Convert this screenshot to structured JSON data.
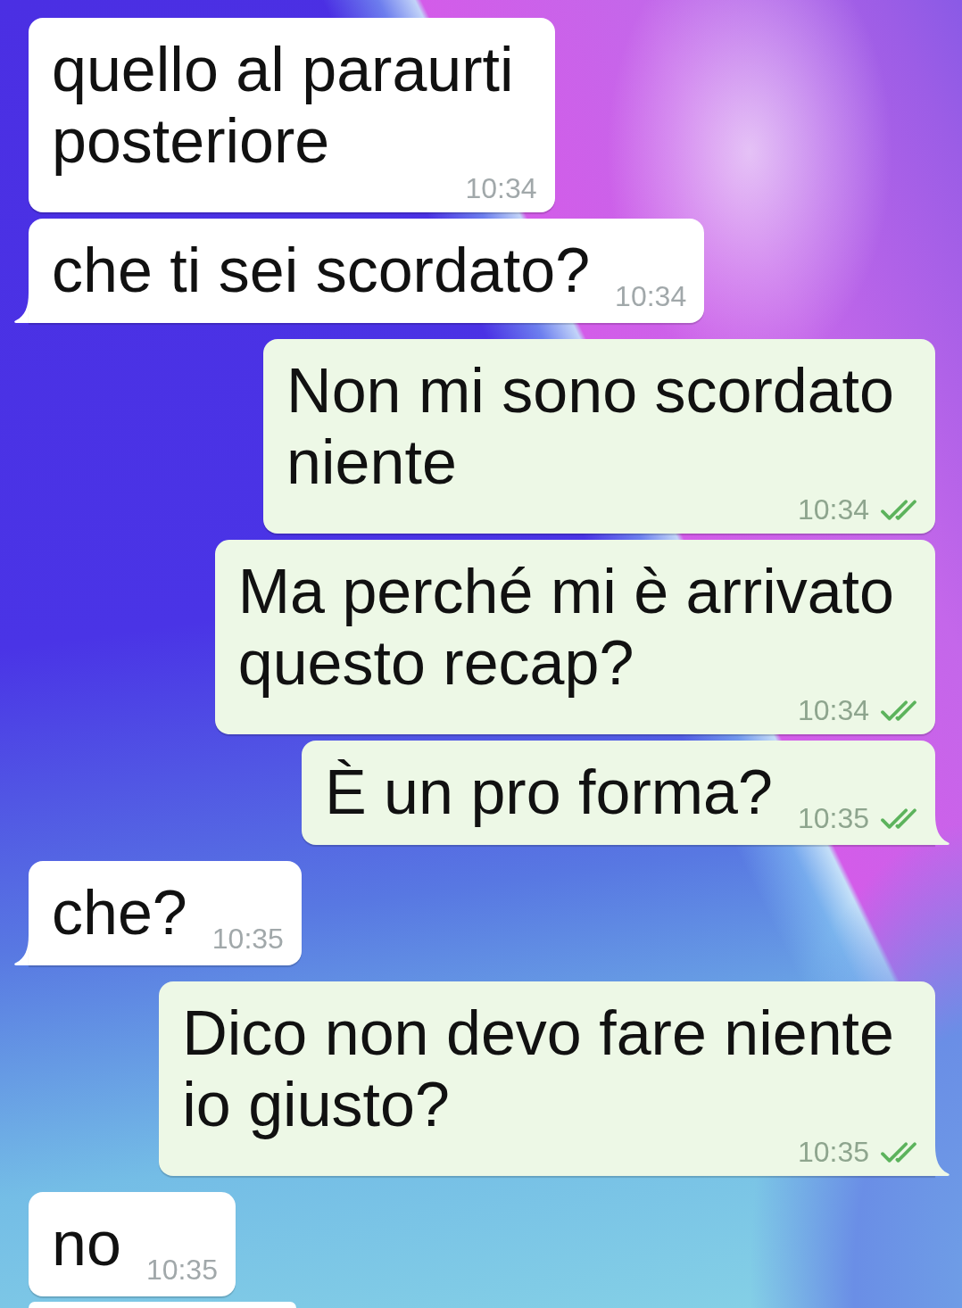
{
  "messages": [
    {
      "kind": "incoming",
      "lines": [
        "quello al paraurti",
        "posteriore"
      ],
      "time": "10:34",
      "tail": false
    },
    {
      "kind": "incoming",
      "lines": [
        "che ti sei scordato?"
      ],
      "time": "10:34",
      "tail": true
    },
    {
      "kind": "outgoing",
      "lines": [
        "Non mi sono scordato",
        "niente"
      ],
      "time": "10:34",
      "read": true,
      "tail": false
    },
    {
      "kind": "outgoing",
      "lines": [
        "Ma perché mi è arrivato",
        "questo recap?"
      ],
      "time": "10:34",
      "read": true,
      "tail": false
    },
    {
      "kind": "outgoing",
      "lines": [
        "È un pro forma?"
      ],
      "time": "10:35",
      "read": true,
      "tail": true
    },
    {
      "kind": "incoming",
      "lines": [
        "che?"
      ],
      "time": "10:35",
      "tail": true
    },
    {
      "kind": "outgoing",
      "lines": [
        "Dico non devo fare niente",
        "io giusto?"
      ],
      "time": "10:35",
      "read": true,
      "tail": true
    },
    {
      "kind": "incoming",
      "lines": [
        "no"
      ],
      "time": "10:35",
      "tail": false
    }
  ],
  "cut_off_bubble": {
    "kind": "incoming"
  }
}
